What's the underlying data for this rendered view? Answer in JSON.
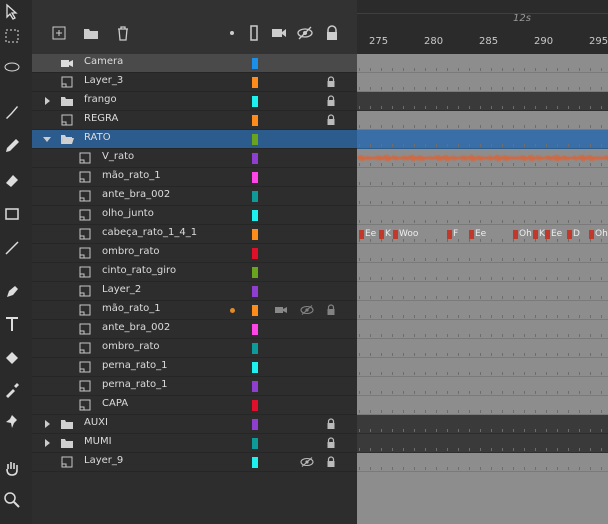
{
  "timeline": {
    "marker_label": "12s",
    "frame_numbers": [
      "275",
      "280",
      "285",
      "290",
      "295"
    ]
  },
  "layers": [
    {
      "name": "Camera",
      "type": "camera",
      "indent": 0,
      "color": "#1e8fe6",
      "lock": false,
      "row_style": "cam"
    },
    {
      "name": "Layer_3",
      "type": "layer",
      "indent": 0,
      "color": "#ff8c1a",
      "lock": true
    },
    {
      "name": "frango",
      "type": "folder",
      "indent": 0,
      "color": "#1ef0f0",
      "lock": true,
      "collapsed": true
    },
    {
      "name": "REGRA",
      "type": "layer",
      "indent": 0,
      "color": "#ff8c1a",
      "lock": true
    },
    {
      "name": "RATO",
      "type": "folder",
      "indent": 0,
      "color": "#6aa31e",
      "lock": false,
      "expanded": true,
      "selected": true
    },
    {
      "name": "V_rato",
      "type": "layer",
      "indent": 1,
      "color": "#8f3fd0",
      "lock": false
    },
    {
      "name": "mão_rato_1",
      "type": "layer",
      "indent": 1,
      "color": "#ff45e6",
      "lock": false
    },
    {
      "name": "ante_bra_002",
      "type": "layer",
      "indent": 1,
      "color": "#0f9a9a",
      "lock": false
    },
    {
      "name": "olho_junto",
      "type": "layer",
      "indent": 1,
      "color": "#1ef0f0",
      "lock": false
    },
    {
      "name": "cabeça_rato_1_4_1",
      "type": "layer",
      "indent": 1,
      "color": "#ff8c1a",
      "lock": false
    },
    {
      "name": "ombro_rato",
      "type": "layer",
      "indent": 1,
      "color": "#e0102a",
      "lock": false
    },
    {
      "name": "cinto_rato_giro",
      "type": "layer",
      "indent": 1,
      "color": "#6aa31e",
      "lock": false
    },
    {
      "name": "Layer_2",
      "type": "layer",
      "indent": 1,
      "color": "#8f3fd0",
      "lock": false
    },
    {
      "name": "mão_rato_1",
      "type": "layer",
      "indent": 1,
      "color": "#ff8c1a",
      "lock": true,
      "hover": true
    },
    {
      "name": "ante_bra_002",
      "type": "layer",
      "indent": 1,
      "color": "#ff45e6",
      "lock": false
    },
    {
      "name": "ombro_rato",
      "type": "layer",
      "indent": 1,
      "color": "#0f9a9a",
      "lock": false
    },
    {
      "name": "perna_rato_1",
      "type": "layer",
      "indent": 1,
      "color": "#1ef0f0",
      "lock": false
    },
    {
      "name": "perna_rato_1",
      "type": "layer",
      "indent": 1,
      "color": "#8f3fd0",
      "lock": false
    },
    {
      "name": "CAPA",
      "type": "layer",
      "indent": 1,
      "color": "#e0102a",
      "lock": false
    },
    {
      "name": "AUXI",
      "type": "folder",
      "indent": 0,
      "color": "#8f3fd0",
      "lock": true,
      "collapsed": true
    },
    {
      "name": "MUMI",
      "type": "folder",
      "indent": 0,
      "color": "#0f9a9a",
      "lock": true,
      "collapsed": true
    },
    {
      "name": "Layer_9",
      "type": "layer",
      "indent": 0,
      "color": "#1ef0f0",
      "lock": true,
      "hidden": true
    }
  ],
  "keyframe_labels": [
    "Ee",
    "K",
    "Woo",
    "F",
    "Ee",
    "Oh",
    "K",
    "Ee",
    "D",
    "Oh"
  ],
  "icons": {
    "add_layer": "plus-square-icon",
    "add_folder": "folder-icon",
    "delete": "trash-icon",
    "highlight": "dot-icon",
    "outline": "outline-icon",
    "camera": "camera-icon",
    "visibility": "eye-slash-icon",
    "lock": "lock-icon"
  }
}
